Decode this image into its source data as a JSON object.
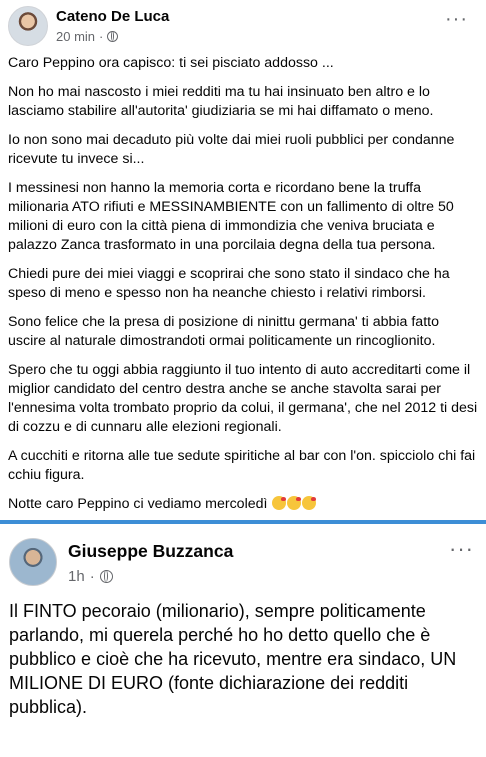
{
  "post1": {
    "author": "Cateno De Luca",
    "time": "20 min",
    "paragraphs": [
      "Caro Peppino ora capisco:  ti sei pisciato addosso ...",
      "Non ho mai nascosto i miei redditi ma tu hai insinuato ben altro e lo lasciamo stabilire all'autorita' giudiziaria se mi hai diffamato o meno.",
      "Io non sono mai decaduto più volte dai miei ruoli pubblici per condanne ricevute tu invece si...",
      "I messinesi non hanno la memoria corta e ricordano bene la truffa milionaria ATO rifiuti e MESSINAMBIENTE con un fallimento di oltre 50 milioni di euro con la città piena di immondizia che veniva bruciata e palazzo Zanca trasformato in una porcilaia degna della tua persona.",
      "Chiedi pure dei miei viaggi e scoprirai che sono stato il sindaco che ha speso di meno e spesso non ha neanche chiesto i relativi rimborsi.",
      "Sono felice che la presa di posizione di ninittu germana' ti abbia fatto uscire al naturale dimostrandoti ormai politicamente un rincoglionito.",
      "Spero che tu oggi abbia raggiunto il tuo intento di auto accreditarti come il miglior candidato del centro destra anche se anche stavolta sarai per l'ennesima volta trombato proprio da colui, il germana', che nel 2012 ti desi di cozzu e di cunnaru alle elezioni regionali.",
      "A cucchiti e ritorna alle tue sedute spiritiche al bar con l'on. spicciolo chi fai cchiu figura.",
      "Notte caro Peppino ci vediamo mercoledì"
    ],
    "emoji_names": [
      "kissing-heart-emoji",
      "kissing-heart-emoji",
      "kissing-heart-emoji"
    ]
  },
  "post2": {
    "author": "Giuseppe Buzzanca",
    "time": "1h",
    "paragraphs": [
      "Il FINTO pecoraio (milionario), sempre politicamente parlando, mi querela perché ho ho detto quello che è pubblico e cioè che ha ricevuto, mentre era sindaco, UN MILIONE DI EURO (fonte dichiarazione dei redditi pubblica)."
    ]
  },
  "icons": {
    "more": "more-options-icon",
    "privacy": "globe-icon"
  },
  "colors": {
    "divider": "#3d8ed6",
    "secondary_text": "#65676b"
  }
}
